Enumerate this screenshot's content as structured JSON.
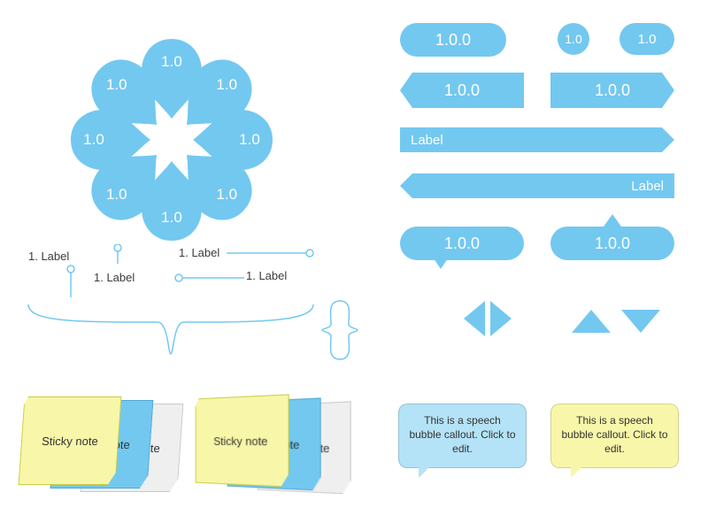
{
  "colors": {
    "blue": "#73C8F0",
    "blue_light": "#B4E2F6",
    "yellow": "#F8F6A8",
    "grey": "#EFEFEF"
  },
  "petals": {
    "count": 8,
    "label": "1.0"
  },
  "pills": {
    "large": {
      "label": "1.0.0"
    },
    "small1": {
      "label": "1.0"
    },
    "small2": {
      "label": "1.0"
    }
  },
  "hex": {
    "left": {
      "label": "1.0.0"
    },
    "right": {
      "label": "1.0.0"
    }
  },
  "banners": {
    "top": {
      "label": "Label"
    },
    "bottom": {
      "label": "Label"
    }
  },
  "speech_pills": {
    "left": {
      "label": "1.0.0"
    },
    "right": {
      "label": "1.0.0"
    }
  },
  "annotations": {
    "a1": "1. Label",
    "a2": "1. Label",
    "a3": "1. Label",
    "a4": "1. Label"
  },
  "sticky": {
    "labels": [
      "Sticky note",
      "Sticky note",
      "Sticky note"
    ]
  },
  "sticky2": {
    "labels": [
      "Sticky note",
      "Sticky note",
      "Sticky note"
    ]
  },
  "callouts": {
    "blue": "This is a speech bubble callout. Click to edit.",
    "yellow": "This is a speech bubble callout. Click to edit."
  }
}
